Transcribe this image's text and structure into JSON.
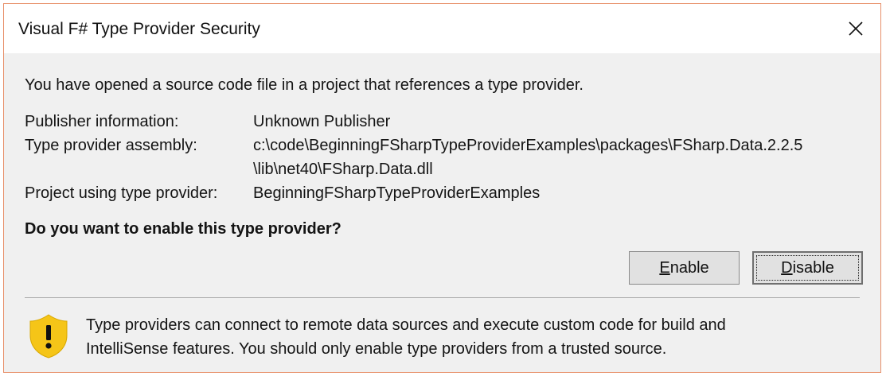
{
  "window": {
    "title": "Visual F# Type Provider Security",
    "close_icon": "close-icon"
  },
  "intro": "You have opened a source code file in a project that references a type provider.",
  "details": [
    {
      "label": "Publisher information:",
      "value": "Unknown Publisher"
    },
    {
      "label": "Type provider assembly:",
      "value": "c:\\code\\BeginningFSharpTypeProviderExamples\\packages\\FSharp.Data.2.2.5",
      "value_cont": "\\lib\\net40\\FSharp.Data.dll"
    },
    {
      "label": "Project using type provider:",
      "value": "BeginningFSharpTypeProviderExamples"
    }
  ],
  "question": "Do you want to enable this type provider?",
  "buttons": {
    "enable": {
      "accel": "E",
      "rest": "nable"
    },
    "disable": {
      "accel": "D",
      "rest": "isable"
    }
  },
  "warning": {
    "icon": "shield-warning-icon",
    "line1": "Type providers can connect to remote data sources and execute custom code for build and",
    "line2": "IntelliSense features.  You should only enable type providers from a trusted source."
  },
  "colors": {
    "window_border": "#e8906a",
    "dialog_background": "#f0f0f0",
    "shield_fill": "#f5c518"
  }
}
